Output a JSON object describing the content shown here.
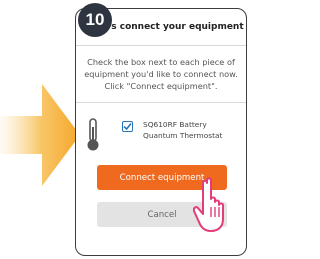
{
  "step_number": "10",
  "dialog": {
    "title": "Let's connect your equipment",
    "instructions": "Check the box next to each piece of equipment you'd like to connect now. Click \"Connect equipment\"."
  },
  "equipment": {
    "label": "SQ610RF Battery Quantum Thermostat",
    "checked": true,
    "icon": "thermostat-icon"
  },
  "buttons": {
    "connect_label": "Connect equipment",
    "cancel_label": "Cancel"
  },
  "colors": {
    "accent": "#ef6a1f",
    "checkbox": "#2a73b6",
    "arrow": "#f7b94a",
    "badge": "#2e3440"
  },
  "decorations": {
    "pointer": "arrow-right-icon",
    "cursor": "hand-pointer-icon"
  }
}
